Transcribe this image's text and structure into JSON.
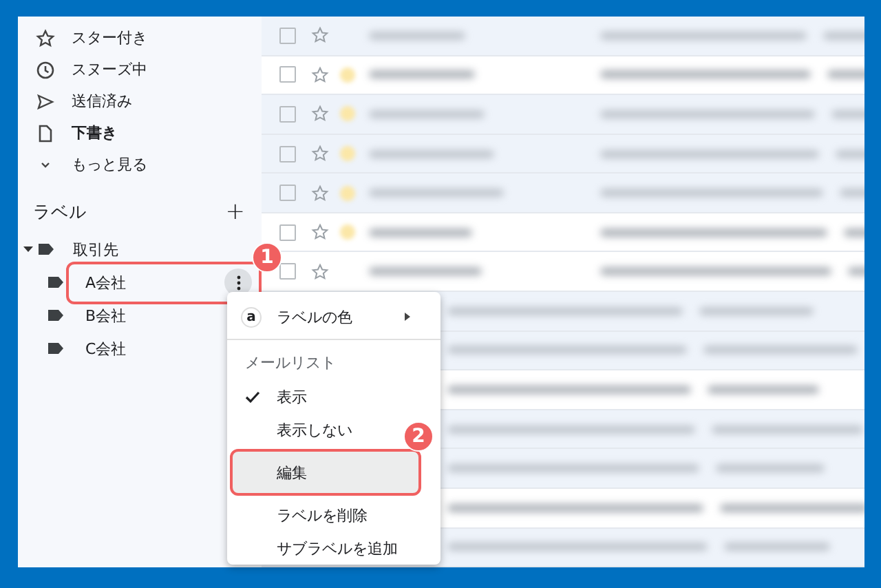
{
  "sidebar": {
    "items": [
      {
        "kind": "star",
        "label": "スター付き",
        "bold": false
      },
      {
        "kind": "clock",
        "label": "スヌーズ中",
        "bold": false
      },
      {
        "kind": "send",
        "label": "送信済み",
        "bold": false
      },
      {
        "kind": "file",
        "label": "下書き",
        "bold": true
      },
      {
        "kind": "more",
        "label": "もっと見る",
        "bold": false
      }
    ],
    "labels_heading": "ラベル",
    "add_button": "+",
    "labels": [
      {
        "name": "取引先",
        "expanded": true,
        "children": [
          {
            "name": "A会社",
            "selected": true,
            "callout": "1"
          },
          {
            "name": "B会社",
            "selected": false
          },
          {
            "name": "C会社",
            "selected": false
          }
        ]
      }
    ]
  },
  "message_rows": [
    {
      "unread": false,
      "important": false
    },
    {
      "unread": true,
      "important": true
    },
    {
      "unread": false,
      "important": true
    },
    {
      "unread": false,
      "important": true
    },
    {
      "unread": false,
      "important": true
    },
    {
      "unread": true,
      "important": true
    },
    {
      "unread": true,
      "important": false
    },
    {
      "unread": false
    },
    {
      "unread": false
    },
    {
      "unread": true
    },
    {
      "unread": false
    },
    {
      "unread": false
    },
    {
      "unread": true
    },
    {
      "unread": false
    }
  ],
  "context_menu": {
    "items": [
      {
        "kind": "submenu",
        "badge": "a",
        "label": "ラベルの色"
      },
      {
        "kind": "divider"
      },
      {
        "kind": "header",
        "label": "メールリスト"
      },
      {
        "kind": "option",
        "label": "表示",
        "checked": true
      },
      {
        "kind": "option",
        "label": "表示しない",
        "checked": false
      },
      {
        "kind": "action",
        "label": "編集",
        "highlighted": true,
        "callout": "2"
      },
      {
        "kind": "action",
        "label": "ラベルを削除",
        "highlighted": false
      },
      {
        "kind": "action",
        "label": "サブラベルを追加",
        "highlighted": false
      }
    ]
  }
}
